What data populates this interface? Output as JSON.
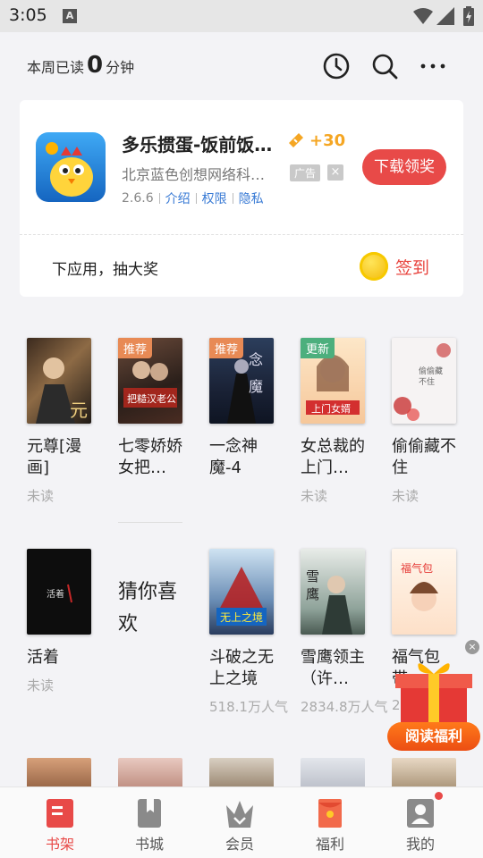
{
  "status_bar": {
    "time": "3:05",
    "notif_letter": "A"
  },
  "header": {
    "reading_prefix": "本周已读",
    "reading_minutes": "0",
    "reading_suffix": "分钟",
    "icons": [
      "history-icon",
      "search-icon",
      "more-icon"
    ]
  },
  "ad": {
    "title": "多乐掼蛋-饭前饭…",
    "bonus": "+30",
    "company": "北京蓝色创想网络科…",
    "tag": "广告",
    "close": "×",
    "version": "2.6.6",
    "links": [
      "介绍",
      "权限",
      "隐私"
    ],
    "download_label": "下载领奖",
    "lottery_text": "下应用，抽大奖",
    "signin_label": "签到"
  },
  "shelf_row1": [
    {
      "title": "元尊[漫画]",
      "status": "未读",
      "badge": ""
    },
    {
      "title": "七零娇娇女把…",
      "status": "",
      "badge": "推荐"
    },
    {
      "title": "一念神魔-4",
      "status": "",
      "badge": "推荐"
    },
    {
      "title": "女总裁的上门…",
      "status": "未读",
      "badge": "更新"
    },
    {
      "title": "偷偷藏不住",
      "status": "未读",
      "badge": ""
    }
  ],
  "shelf_row2": [
    {
      "title": "活着",
      "status": "未读"
    }
  ],
  "guess": {
    "label": "猜你喜欢"
  },
  "recommend": [
    {
      "title": "斗破之无上之境",
      "popularity": "518.1万人气"
    },
    {
      "title": "雪鹰领主（许…",
      "popularity": "2834.8万人气"
    },
    {
      "title": "福气包带…",
      "popularity": "2"
    }
  ],
  "gift": {
    "label": "阅读福利",
    "close": "×"
  },
  "nav": [
    {
      "label": "书架",
      "active": true
    },
    {
      "label": "书城",
      "active": false
    },
    {
      "label": "会员",
      "active": false
    },
    {
      "label": "福利",
      "active": false
    },
    {
      "label": "我的",
      "active": false
    }
  ],
  "colors": {
    "accent": "#e84a48",
    "bonus": "#f5a623",
    "link": "#3a7bd5",
    "background": "#f3f3f6"
  }
}
